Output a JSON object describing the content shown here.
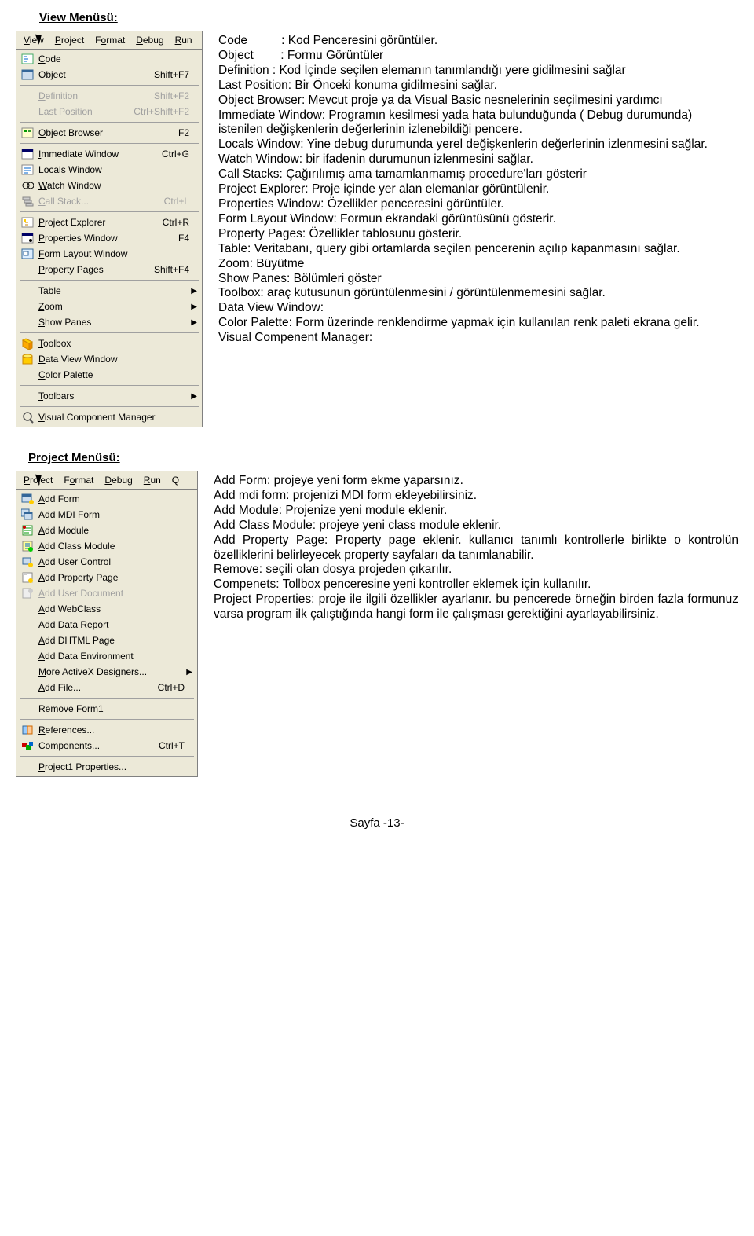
{
  "view_section_title": "View Menüsü:",
  "project_section_title": "Project  Menüsü:",
  "menubar_view": [
    "View",
    "Project",
    "Format",
    "Debug",
    "Run"
  ],
  "menubar_project": [
    "Project",
    "Format",
    "Debug",
    "Run",
    "Q"
  ],
  "menubar_u_view": [
    "V",
    "P",
    "o",
    "D",
    "R"
  ],
  "menubar_u_project": [
    "P",
    "o",
    "D",
    "R",
    ""
  ],
  "view_menu": [
    {
      "icon": "code",
      "label": "Code",
      "shortcut": "",
      "disabled": false
    },
    {
      "icon": "object",
      "label": "Object",
      "shortcut": "Shift+F7",
      "disabled": false
    },
    {
      "sep": true
    },
    {
      "icon": "",
      "label": "Definition",
      "shortcut": "Shift+F2",
      "disabled": true
    },
    {
      "icon": "",
      "label": "Last Position",
      "shortcut": "Ctrl+Shift+F2",
      "disabled": true
    },
    {
      "sep": true
    },
    {
      "icon": "browser",
      "label": "Object Browser",
      "shortcut": "F2",
      "disabled": false
    },
    {
      "sep": true
    },
    {
      "icon": "imm",
      "label": "Immediate Window",
      "shortcut": "Ctrl+G",
      "disabled": false
    },
    {
      "icon": "locals",
      "label": "Locals Window",
      "shortcut": "",
      "disabled": false
    },
    {
      "icon": "watch",
      "label": "Watch Window",
      "shortcut": "",
      "disabled": false
    },
    {
      "icon": "stack",
      "label": "Call Stack...",
      "shortcut": "Ctrl+L",
      "disabled": true
    },
    {
      "sep": true
    },
    {
      "icon": "proj",
      "label": "Project Explorer",
      "shortcut": "Ctrl+R",
      "disabled": false
    },
    {
      "icon": "props",
      "label": "Properties Window",
      "shortcut": "F4",
      "disabled": false
    },
    {
      "icon": "layout",
      "label": "Form Layout Window",
      "shortcut": "",
      "disabled": false
    },
    {
      "icon": "",
      "label": "Property Pages",
      "shortcut": "Shift+F4",
      "disabled": false
    },
    {
      "sep": true
    },
    {
      "icon": "",
      "label": "Table",
      "shortcut": "",
      "submenu": true,
      "disabled": false
    },
    {
      "icon": "",
      "label": "Zoom",
      "shortcut": "",
      "submenu": true,
      "disabled": false
    },
    {
      "icon": "",
      "label": "Show Panes",
      "shortcut": "",
      "submenu": true,
      "disabled": false
    },
    {
      "sep": true
    },
    {
      "icon": "toolbox",
      "label": "Toolbox",
      "shortcut": "",
      "disabled": false
    },
    {
      "icon": "dataview",
      "label": "Data View Window",
      "shortcut": "",
      "disabled": false
    },
    {
      "icon": "",
      "label": "Color Palette",
      "shortcut": "",
      "disabled": false
    },
    {
      "sep": true
    },
    {
      "icon": "",
      "label": "Toolbars",
      "shortcut": "",
      "submenu": true,
      "disabled": false
    },
    {
      "sep": true
    },
    {
      "icon": "vcm",
      "label": "Visual Component Manager",
      "shortcut": "",
      "disabled": false
    }
  ],
  "project_menu": [
    {
      "icon": "form",
      "label": "Add Form",
      "shortcut": "",
      "disabled": false
    },
    {
      "icon": "mdi",
      "label": "Add MDI Form",
      "shortcut": "",
      "disabled": false
    },
    {
      "icon": "module",
      "label": "Add Module",
      "shortcut": "",
      "disabled": false
    },
    {
      "icon": "class",
      "label": "Add Class Module",
      "shortcut": "",
      "disabled": false
    },
    {
      "icon": "uctrl",
      "label": "Add User Control",
      "shortcut": "",
      "disabled": false
    },
    {
      "icon": "ppage",
      "label": "Add Property Page",
      "shortcut": "",
      "disabled": false
    },
    {
      "icon": "udoc",
      "label": "Add User Document",
      "shortcut": "",
      "disabled": true
    },
    {
      "icon": "",
      "label": "Add WebClass",
      "shortcut": "",
      "disabled": false
    },
    {
      "icon": "",
      "label": "Add Data Report",
      "shortcut": "",
      "disabled": false
    },
    {
      "icon": "",
      "label": "Add DHTML Page",
      "shortcut": "",
      "disabled": false
    },
    {
      "icon": "",
      "label": "Add Data Environment",
      "shortcut": "",
      "disabled": false
    },
    {
      "icon": "",
      "label": "More ActiveX Designers...",
      "shortcut": "",
      "submenu": true,
      "disabled": false
    },
    {
      "icon": "",
      "label": "Add File...",
      "shortcut": "Ctrl+D",
      "disabled": false
    },
    {
      "sep": true
    },
    {
      "icon": "",
      "label": "Remove Form1",
      "shortcut": "",
      "disabled": false
    },
    {
      "sep": true
    },
    {
      "icon": "ref",
      "label": "References...",
      "shortcut": "",
      "disabled": false
    },
    {
      "icon": "comp",
      "label": "Components...",
      "shortcut": "Ctrl+T",
      "disabled": false
    },
    {
      "sep": true
    },
    {
      "icon": "",
      "label": "Project1 Properties...",
      "shortcut": "",
      "disabled": false
    }
  ],
  "view_desc": {
    "l1": "Code          : Kod Penceresini görüntüler.",
    "l2": "Object        : Formu Görüntüler",
    "l3": "Definition    : Kod İçinde seçilen elemanın tanımlandığı yere gidilmesini sağlar",
    "l4": "Last Position: Bir Önceki konuma gidilmesini sağlar.",
    "l5": "Object Browser: Mevcut proje ya da Visual Basic nesnelerinin seçilmesini yardımcı",
    "l6": "Immediate Window: Programın kesilmesi yada hata bulunduğunda ( Debug durumunda) istenilen değişkenlerin değerlerinin izlenebildiği pencere.",
    "l7": "Locals Window: Yine debug durumunda yerel değişkenlerin değerlerinin  izlenmesini sağlar.",
    "l8": "Watch Window: bir ifadenin durumunun izlenmesini sağlar.",
    "l9": "Call Stacks: Çağırılımış ama tamamlanmamış procedure'ları gösterir",
    "l10": "Project Explorer: Proje içinde yer alan elemanlar görüntülenir.",
    "l11": "Properties Window: Özellikler penceresini görüntüler.",
    "l12": "Form Layout Window: Formun ekrandaki görüntüsünü gösterir.",
    "l13": "Property Pages: Özellikler tablosunu gösterir.",
    "l14": "Table: Veritabanı,  query gibi ortamlarda seçilen pencerenin açılıp kapanmasını sağlar.",
    "l15": "Zoom: Büyütme",
    "l16": "Show Panes: Bölümleri göster",
    "l17": "Toolbox: araç kutusunun görüntülenmesini / görüntülenmemesini sağlar.",
    "l18": "Data View Window:",
    "l19": "Color Palette: Form üzerinde renklendirme yapmak için kullanılan renk paleti ekrana gelir.",
    "l20": "Visual Compenent Manager:"
  },
  "project_desc": {
    "l1": "Add Form: projeye yeni form ekme yaparsınız.",
    "l2": "Add mdi form: projenizi MDI form ekleyebilirsiniz.",
    "l3": "Add Module: Projenize yeni module eklenir.",
    "l4": "Add Class Module: projeye yeni class module eklenir.",
    "l5": "Add Property Page: Property page eklenir. kullanıcı tanımlı kontrollerle birlikte    o kontrolün özelliklerini belirleyecek property sayfaları da tanımlanabilir.",
    "l6": "Remove: seçili olan dosya projeden çıkarılır.",
    "l7": "Compenets: Tollbox penceresine yeni kontroller eklemek için kullanılır.",
    "l8": "Project Properties: proje ile ilgili özellikler ayarlanır. bu pencerede örneğin birden fazla formunuz varsa program ilk çalıştığında hangi form ile çalışması gerektiğini ayarlayabilirsiniz."
  },
  "footer": "Sayfa -13-"
}
